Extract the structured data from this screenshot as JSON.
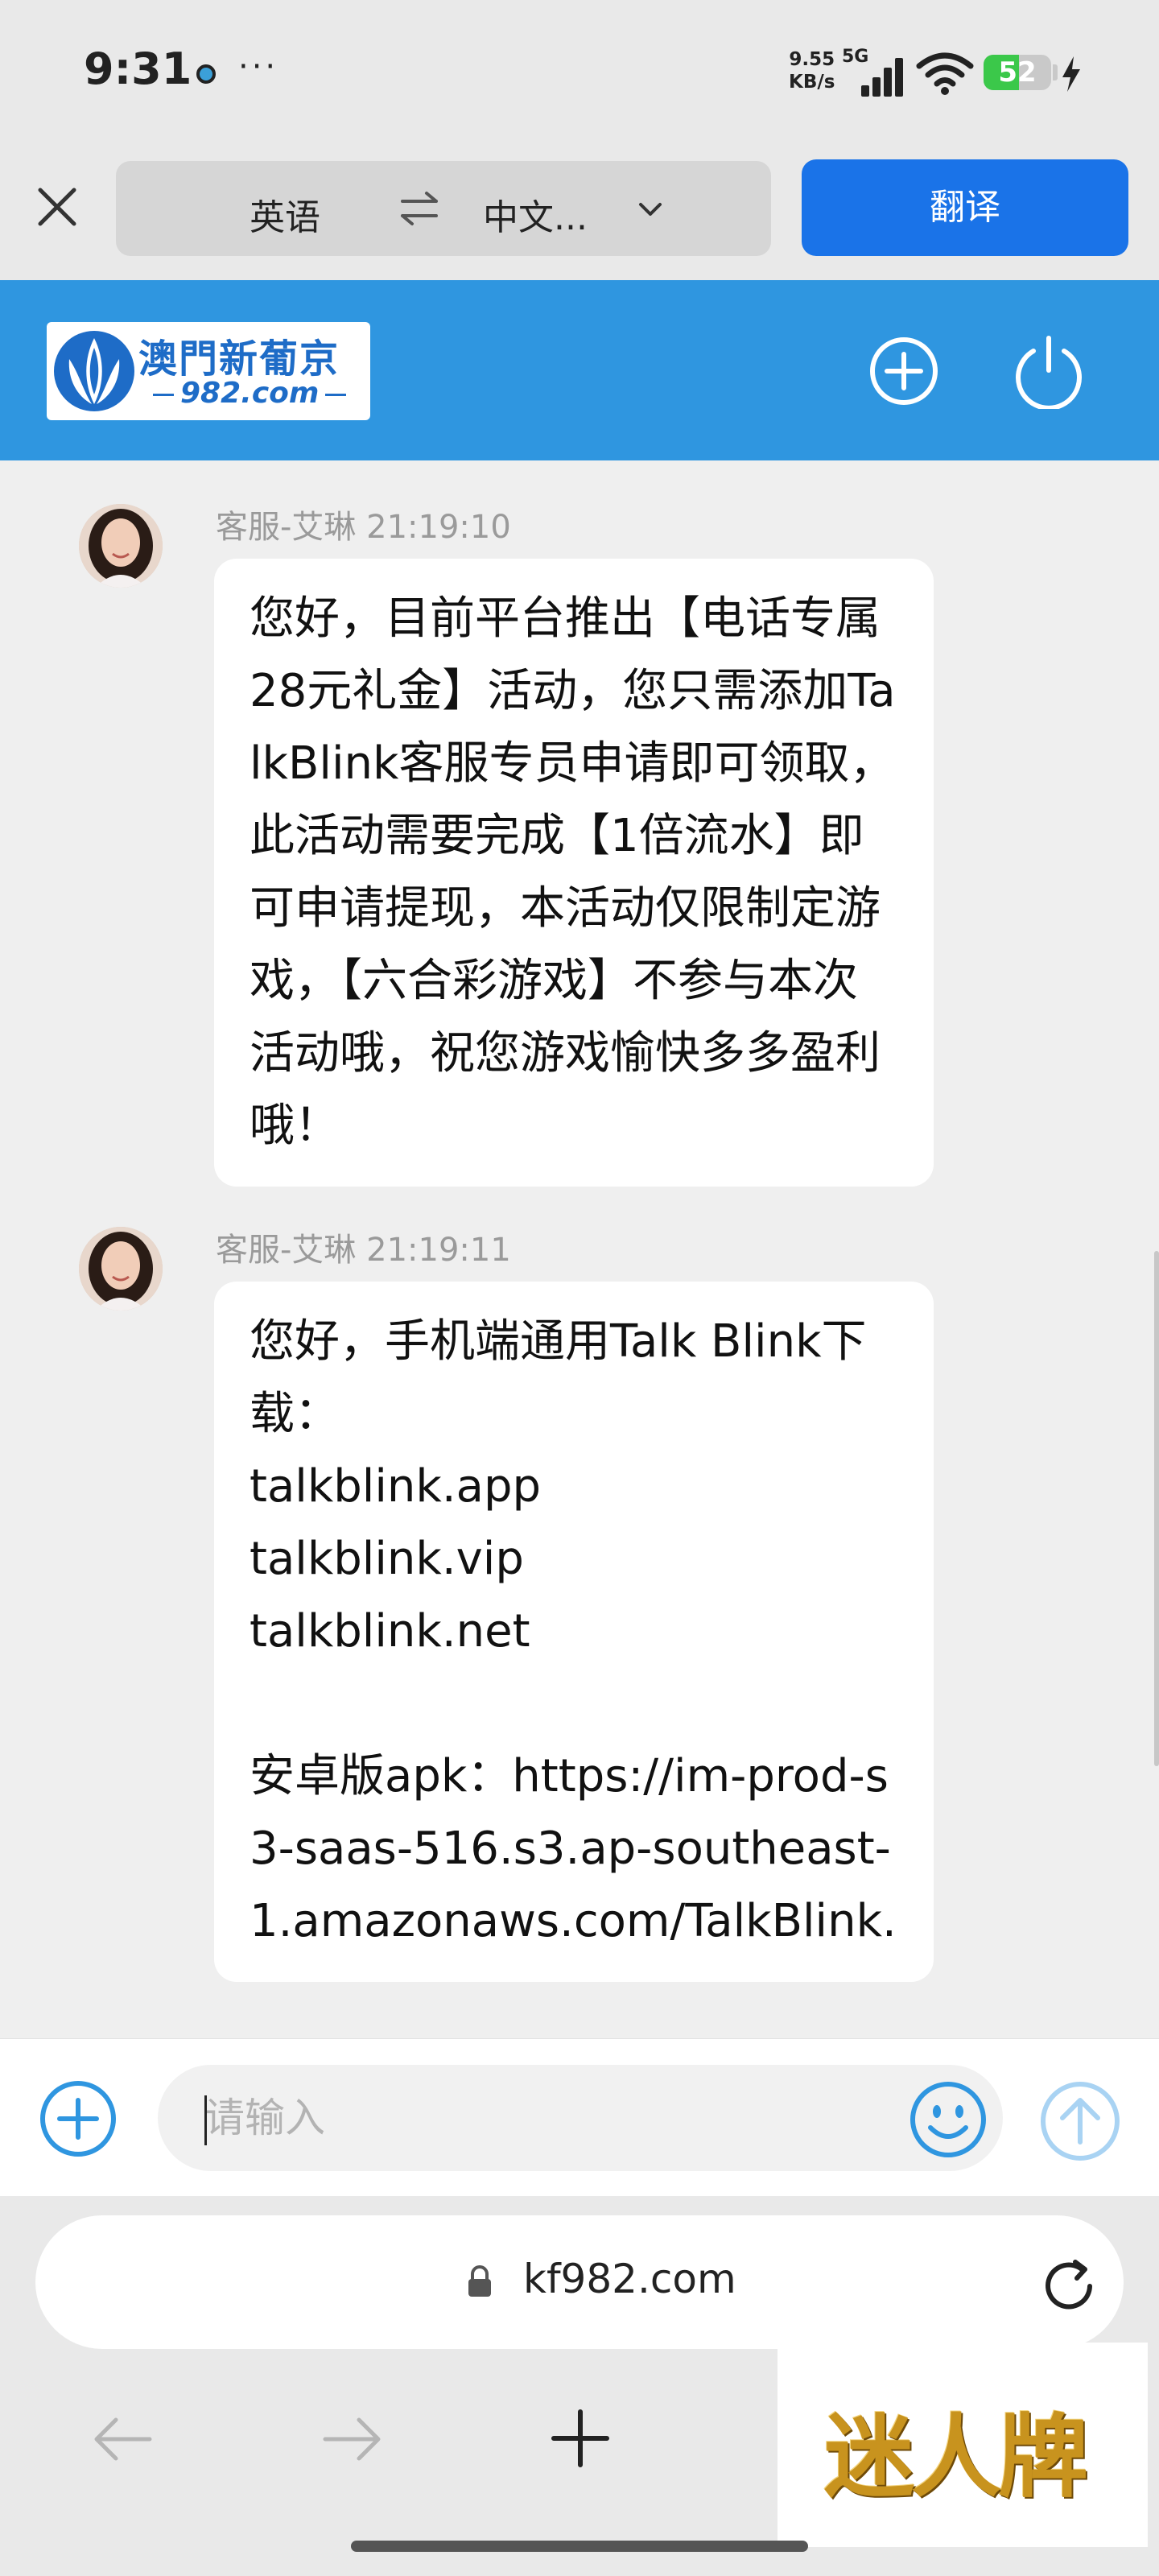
{
  "status_bar": {
    "time": "9:31",
    "more": "···",
    "net_speed_value": "9.55",
    "net_speed_unit": "KB/s",
    "network": "5G",
    "battery": "52"
  },
  "translate_bar": {
    "source_lang": "英语",
    "target_lang": "中文...",
    "translate_button": "翻译"
  },
  "header": {
    "logo_text": "澳門新葡京",
    "logo_url": "982.com"
  },
  "messages": [
    {
      "sender": "客服-艾琳",
      "time": "21:19:10",
      "text": "您好，目前平台推出【电话专属28元礼金】活动，您只需添加TalkBlink客服专员申请即可领取，此活动需要完成【1倍流水】即可申请提现，本活动仅限制定游戏，【六合彩游戏】不参与本次活动哦，祝您游戏愉快多多盈利哦！"
    },
    {
      "sender": "客服-艾琳",
      "time": "21:19:11",
      "text": "您好，手机端通用Talk Blink下载：\ntalkblink.app\ntalkblink.vip\ntalkblink.net\n\n安卓版apk：https://im-prod-s3-saas-516.s3.ap-southeast-1.amazonaws.com/TalkBlink."
    }
  ],
  "input": {
    "placeholder": "请输入"
  },
  "browser": {
    "url": "kf982.com"
  },
  "watermark": {
    "text": "迷人牌"
  },
  "colors": {
    "header_blue": "#2f96e0",
    "translate_button": "#1a73e8",
    "battery_green": "#3bc84a",
    "watermark_gold": "#c8931e"
  }
}
